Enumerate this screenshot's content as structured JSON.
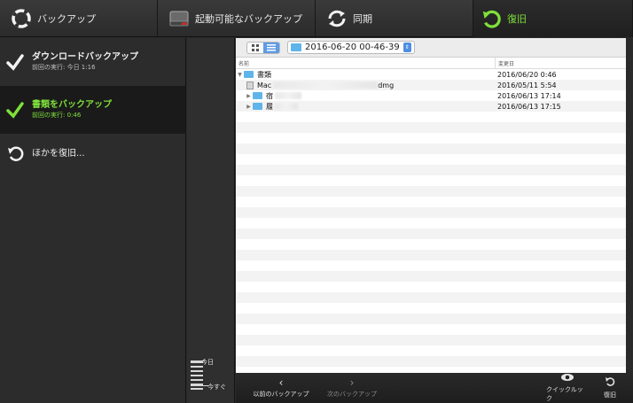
{
  "toolbar": {
    "backup": "バックアップ",
    "bootable": "起動可能なバックアップ",
    "sync": "同期",
    "restore": "復旧"
  },
  "sidebar": {
    "items": [
      {
        "title": "ダウンロードバックアップ",
        "sub": "前回の実行: 今日 1:16",
        "active": false
      },
      {
        "title": "書類をバックアップ",
        "sub": "前回の実行: 0:46",
        "active": true
      }
    ],
    "restore_other": "ほかを復旧..."
  },
  "timeline": {
    "today": "今日",
    "now": "今すぐ"
  },
  "browser": {
    "path": "2016-06-20 00-46-39",
    "col_name": "名前",
    "col_modified": "変更日",
    "rows": [
      {
        "name": "書類",
        "date": "2016/06/20 0:46",
        "kind": "folder",
        "expanded": true,
        "indent": 0
      },
      {
        "name": "Mac",
        "date": "2016/05/11 5:54",
        "kind": "file",
        "suffix": "dmg",
        "indent": 1
      },
      {
        "name": "宿",
        "date": "2016/06/13 17:14",
        "kind": "folder",
        "expanded": false,
        "indent": 1
      },
      {
        "name": "履",
        "date": "2016/06/13 17:15",
        "kind": "folder",
        "expanded": false,
        "indent": 1
      }
    ]
  },
  "bottombar": {
    "prev": "以前のバックアップ",
    "next": "次のバックアップ",
    "quicklook": "クイックルック",
    "restore": "復旧"
  },
  "colors": {
    "accent": "#7fe03a",
    "folder": "#5fb4ea",
    "selected_segment": "#5f9be6"
  }
}
